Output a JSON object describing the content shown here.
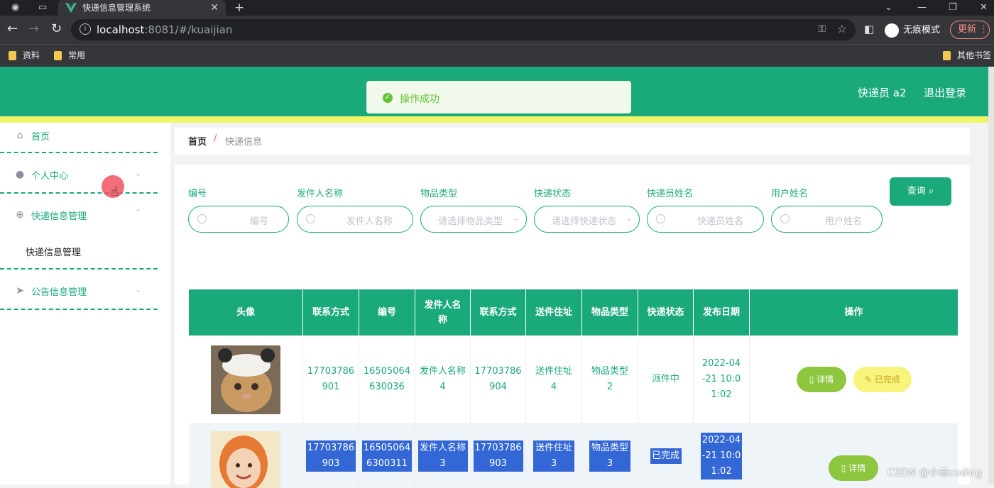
{
  "browser": {
    "tab_title": "快递信息管理系统",
    "url_host": "localhost",
    "url_rest": ":8081/#/kuaijian",
    "incognito_label": "无痕模式",
    "update_label": "更新",
    "bookmarks": [
      "资料",
      "常用"
    ],
    "other_bookmarks": "其他书签"
  },
  "header": {
    "toast": "操作成功",
    "user": "快递员 a2",
    "logout": "退出登录"
  },
  "sidebar": {
    "items": [
      {
        "label": "首页"
      },
      {
        "label": "个人中心"
      },
      {
        "label": "快递信息管理"
      },
      {
        "label": "公告信息管理"
      }
    ],
    "submenu": "快递信息管理"
  },
  "breadcrumb": {
    "home": "首页",
    "sep": "/",
    "current": "快递信息"
  },
  "search": {
    "fields": [
      {
        "label": "编号",
        "placeholder": "编号"
      },
      {
        "label": "发件人名称",
        "placeholder": "发件人名称"
      },
      {
        "label": "物品类型",
        "placeholder": "请选择物品类型"
      },
      {
        "label": "快递状态",
        "placeholder": "请选择快递状态"
      },
      {
        "label": "快递员姓名",
        "placeholder": "快递员姓名"
      },
      {
        "label": "用户姓名",
        "placeholder": "用户姓名"
      }
    ],
    "query_button": "查询"
  },
  "table": {
    "headers": [
      "头像",
      "联系方式",
      "编号",
      "发件人名称",
      "联系方式",
      "送件住址",
      "物品类型",
      "快递状态",
      "发布日期",
      "操作"
    ],
    "rows": [
      {
        "contact": "17703786901",
        "id": "16505064630036",
        "sender": "发件人名称4",
        "contact2": "17703786904",
        "address": "送件住址4",
        "type": "物品类型2",
        "status": "派件中",
        "date": "2022-04-21 10:01:02",
        "btn_detail": "详情",
        "btn_done": "已完成"
      },
      {
        "contact": "17703786903",
        "id": "165050646300311",
        "sender": "发件人名称3",
        "contact2": "17703786903",
        "address": "送件住址3",
        "type": "物品类型3",
        "status": "已完成",
        "date": "2022-04-21 10:01:02",
        "btn_detail": "详情"
      }
    ]
  },
  "watermark": "CSDN @小蔡coding"
}
